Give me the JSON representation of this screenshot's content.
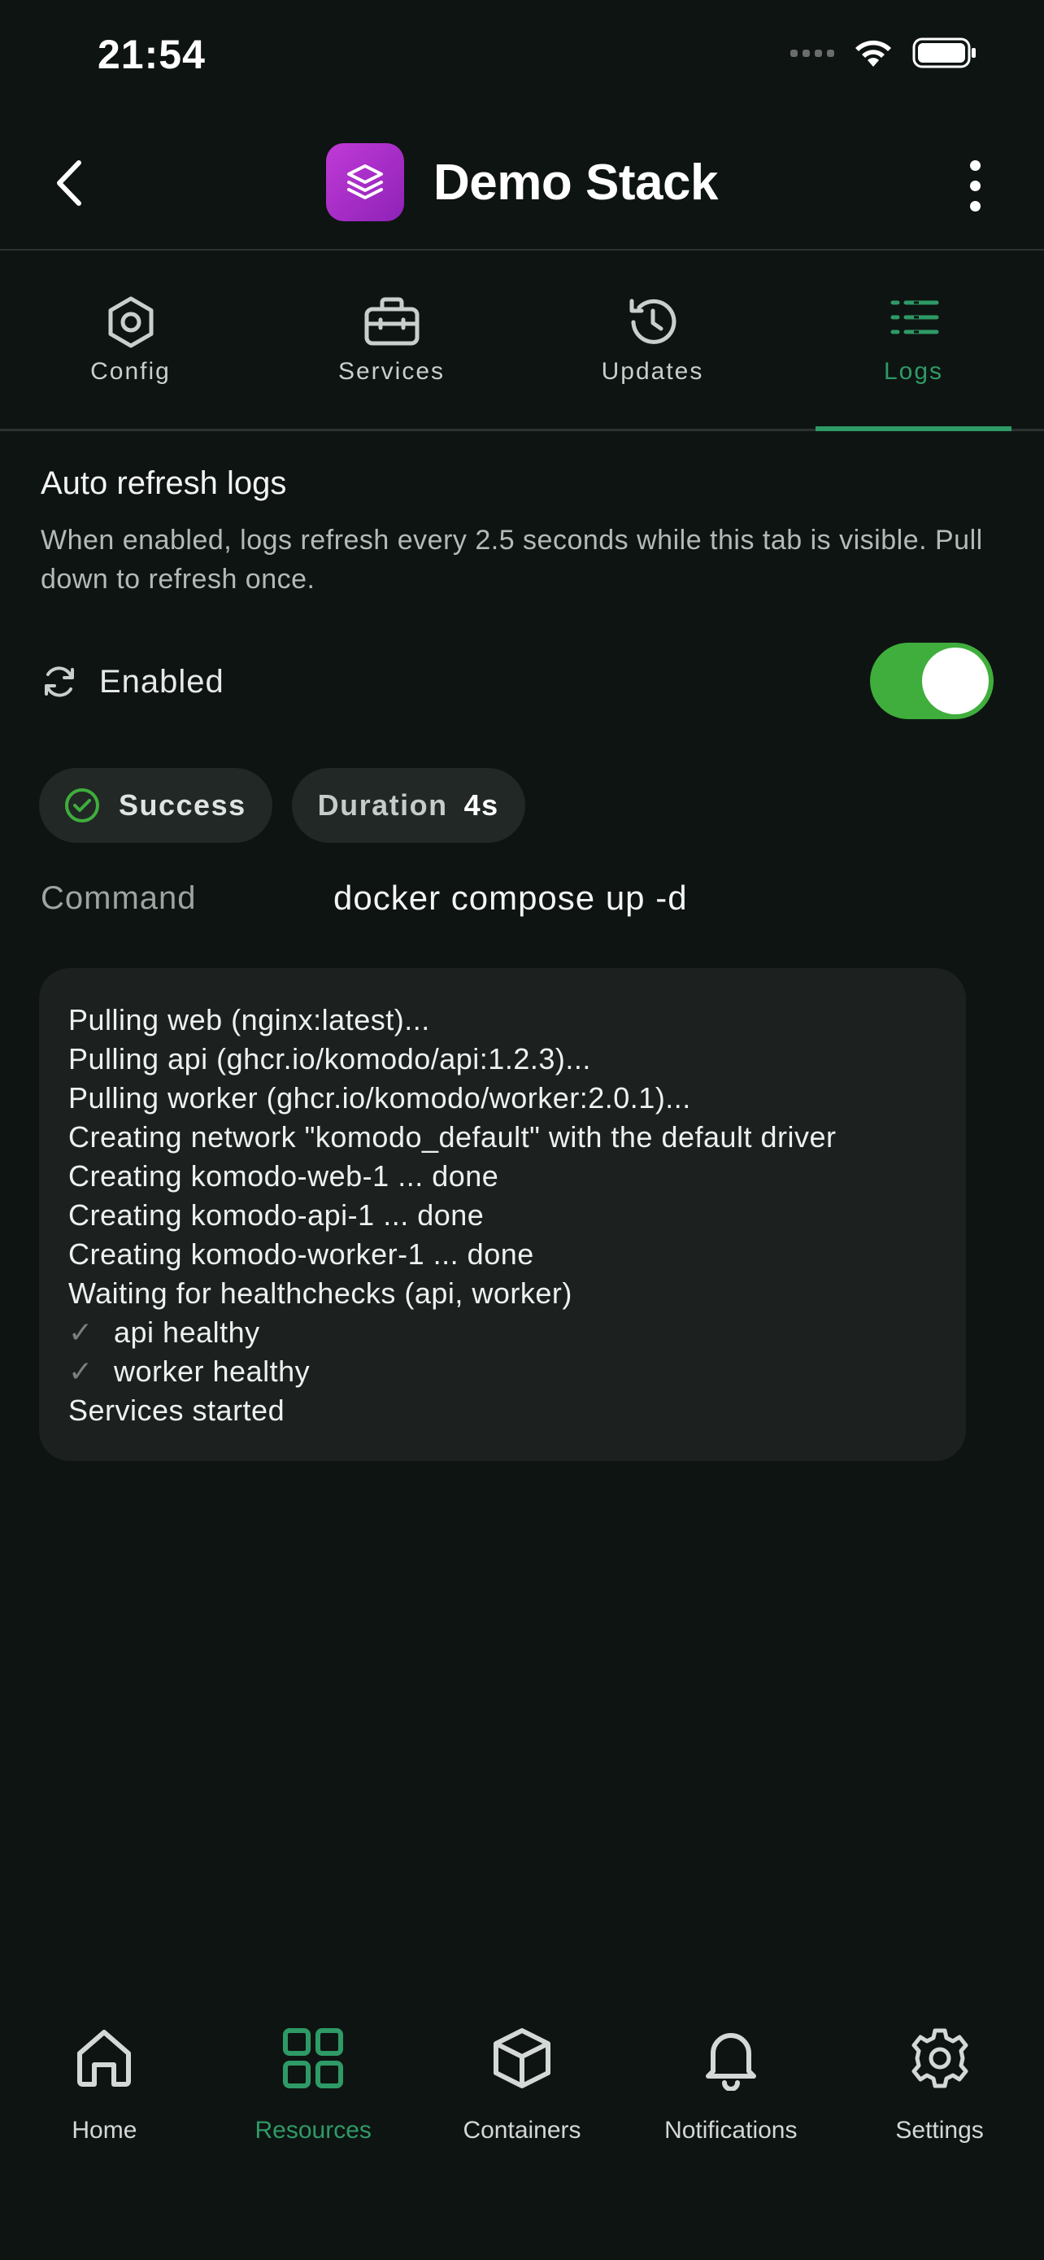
{
  "status_bar": {
    "time": "21:54"
  },
  "header": {
    "title": "Demo Stack"
  },
  "tabs": [
    {
      "label": "Config",
      "icon": "hexagon-cog-icon",
      "active": false
    },
    {
      "label": "Services",
      "icon": "toolbox-icon",
      "active": false
    },
    {
      "label": "Updates",
      "icon": "history-icon",
      "active": false
    },
    {
      "label": "Logs",
      "icon": "list-icon",
      "active": true
    }
  ],
  "auto_refresh": {
    "title": "Auto refresh logs",
    "description": "When enabled, logs refresh every 2.5 seconds while this tab is visible. Pull down to refresh once.",
    "enabled_label": "Enabled",
    "enabled": true
  },
  "status": {
    "success_label": "Success",
    "duration_label": "Duration",
    "duration_value": "4s"
  },
  "command": {
    "label": "Command",
    "value": "docker compose up -d"
  },
  "logs": [
    {
      "text": "Pulling web (nginx:latest)...",
      "check": false
    },
    {
      "text": "Pulling api (ghcr.io/komodo/api:1.2.3)...",
      "check": false
    },
    {
      "text": "Pulling worker (ghcr.io/komodo/worker:2.0.1)...",
      "check": false
    },
    {
      "text": "Creating network \"komodo_default\" with the default driver",
      "check": false
    },
    {
      "text": "Creating komodo-web-1 ... done",
      "check": false
    },
    {
      "text": "Creating komodo-api-1 ... done",
      "check": false
    },
    {
      "text": "Creating komodo-worker-1 ... done",
      "check": false
    },
    {
      "text": "Waiting for healthchecks (api, worker)",
      "check": false
    },
    {
      "text": "api healthy",
      "check": true
    },
    {
      "text": "worker healthy",
      "check": true
    },
    {
      "text": "Services started",
      "check": false
    }
  ],
  "check_glyph": "✓",
  "bottom_nav": [
    {
      "label": "Home",
      "icon": "home-icon",
      "active": false
    },
    {
      "label": "Resources",
      "icon": "grid-icon",
      "active": true
    },
    {
      "label": "Containers",
      "icon": "cube-icon",
      "active": false
    },
    {
      "label": "Notifications",
      "icon": "bell-icon",
      "active": false
    },
    {
      "label": "Settings",
      "icon": "gear-icon",
      "active": false
    }
  ],
  "colors": {
    "background": "#0e1412",
    "accent": "#2e9a66",
    "toggle_on": "#3fae3c",
    "app_icon": "#b030cc"
  }
}
